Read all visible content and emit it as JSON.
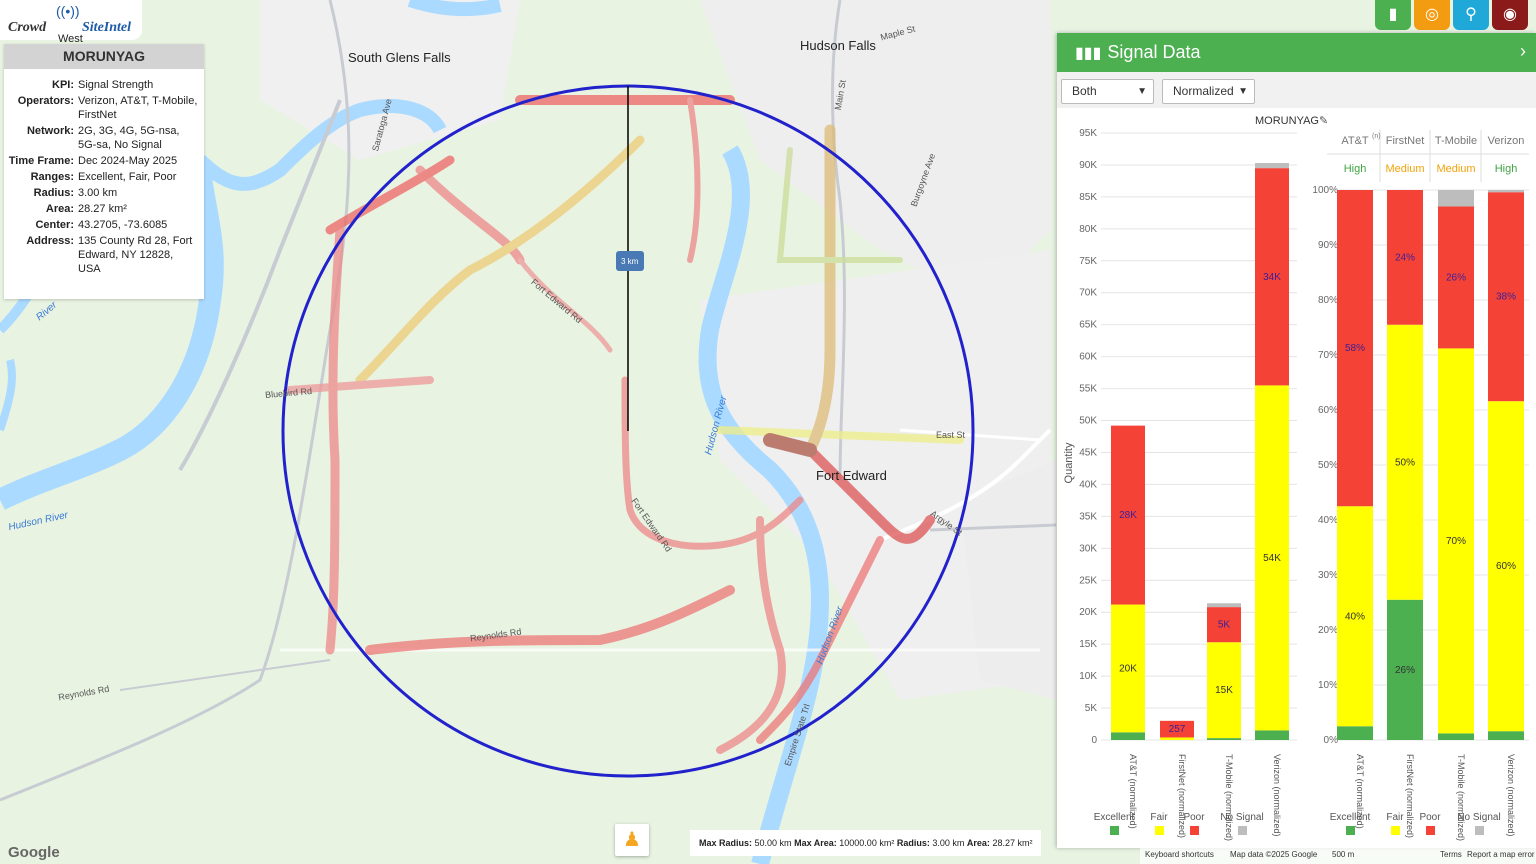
{
  "logo": {
    "word1": "Crowd",
    "word2": "SiteIntel",
    "under": "West"
  },
  "info": {
    "title": "MORUNYAG",
    "rows": [
      {
        "k": "KPI:",
        "v": "Signal Strength"
      },
      {
        "k": "Operators:",
        "v": "Verizon, AT&T, T-Mobile, FirstNet"
      },
      {
        "k": "Network:",
        "v": "2G, 3G, 4G, 5G-nsa, 5G-sa, No Signal"
      },
      {
        "k": "Time Frame:",
        "v": "Dec 2024-May 2025"
      },
      {
        "k": "Ranges:",
        "v": "Excellent, Fair, Poor"
      },
      {
        "k": "Radius:",
        "v": "3.00 km"
      },
      {
        "k": "Area:",
        "v": "28.27 km²"
      },
      {
        "k": "Center:",
        "v": "43.2705, -73.6085"
      },
      {
        "k": "Address:",
        "v": "135 County Rd 28, Fort Edward, NY 12828, USA"
      }
    ]
  },
  "toolbar": {
    "buttons": [
      {
        "name": "signal-data-button",
        "icon": "bar-chart-icon",
        "glyph": "▮",
        "color": "#4caf50"
      },
      {
        "name": "target-button",
        "icon": "target-icon",
        "glyph": "◎",
        "color": "#f39c12"
      },
      {
        "name": "location-button",
        "icon": "map-pin-icon",
        "glyph": "⚲",
        "color": "#1fa8d8"
      },
      {
        "name": "globe-button",
        "icon": "globe-icon",
        "glyph": "◉",
        "color": "#8b1a1a"
      }
    ]
  },
  "panel": {
    "title": "Signal Data",
    "select1": "Both",
    "select2": "Normalized",
    "chart_title": "MORUNYAG"
  },
  "map": {
    "labels": {
      "south_glens_falls": "South Glens Falls",
      "hudson_falls": "Hudson Falls",
      "fort_edward": "Fort Edward",
      "scale": "3 km",
      "river1": "Hudson River",
      "river2": "Hudson River",
      "river3": "Hudson River",
      "river4": "River",
      "road1": "Fort Edward Rd",
      "road2": "Fort Edward Rd",
      "road3": "Reynolds Rd",
      "road4": "Bluebird Rd",
      "road5": "East St",
      "road6": "Maple St",
      "road7": "Burgoyne Ave",
      "road8": "Reynolds Rd",
      "road9": "Saratoga Ave",
      "road10": "Main St",
      "road11": "Empire State Trl",
      "road12": "Argyle St"
    },
    "footer": {
      "max_radius_label": "Max Radius:",
      "max_radius": "50.00 km",
      "max_area_label": "Max Area:",
      "max_area": "10000.00 km²",
      "radius_label": "Radius:",
      "radius": "3.00 km",
      "area_label": "Area:",
      "area": "28.27 km²"
    },
    "attribution": {
      "keyboard": "Keyboard shortcuts",
      "mapdata": "Map data ©2025 Google",
      "scale": "500 m",
      "terms": "Terms",
      "report": "Report a map error"
    },
    "google": "Google"
  },
  "chart_data": [
    {
      "type": "bar",
      "stacked": true,
      "title": "MORUNYAG",
      "ylabel": "Quantity",
      "ylim": [
        0,
        95000
      ],
      "yticks": [
        "0",
        "5K",
        "10K",
        "15K",
        "20K",
        "25K",
        "30K",
        "35K",
        "40K",
        "45K",
        "50K",
        "55K",
        "60K",
        "65K",
        "70K",
        "75K",
        "80K",
        "85K",
        "90K",
        "95K"
      ],
      "categories": [
        "AT&T (normalized)",
        "FirstNet (normalized)",
        "T-Mobile (normalized)",
        "Verizon (normalized)"
      ],
      "series": [
        {
          "name": "Excellent",
          "color": "#4caf50",
          "values": [
            1200,
            0,
            300,
            1500
          ]
        },
        {
          "name": "Fair",
          "color": "#ffff00",
          "values": [
            20000,
            400,
            15000,
            54000
          ]
        },
        {
          "name": "Poor",
          "color": "#f44336",
          "values": [
            28000,
            2600,
            5500,
            34000
          ]
        },
        {
          "name": "No Signal",
          "color": "#bdbdbd",
          "values": [
            0,
            0,
            600,
            800
          ]
        }
      ],
      "data_labels": [
        {
          "cat": 0,
          "series": 1,
          "text": "20K"
        },
        {
          "cat": 0,
          "series": 2,
          "text": "28K"
        },
        {
          "cat": 1,
          "series": 2,
          "text": "257"
        },
        {
          "cat": 2,
          "series": 1,
          "text": "15K"
        },
        {
          "cat": 2,
          "series": 2,
          "text": "5K"
        },
        {
          "cat": 3,
          "series": 1,
          "text": "54K"
        },
        {
          "cat": 3,
          "series": 2,
          "text": "34K"
        }
      ]
    },
    {
      "type": "bar",
      "stacked": true,
      "ylim": [
        0,
        100
      ],
      "yticks": [
        "0%",
        "10%",
        "20%",
        "30%",
        "40%",
        "50%",
        "60%",
        "70%",
        "80%",
        "90%",
        "100%"
      ],
      "categories": [
        "AT&T (normalized)",
        "FirstNet (normalized)",
        "T-Mobile (normalized)",
        "Verizon (normalized)"
      ],
      "column_headers": [
        "AT&T",
        "FirstNet",
        "T-Mobile",
        "Verizon"
      ],
      "column_header_suffix": "(n)",
      "ratings": [
        {
          "text": "High",
          "color": "#3ea541"
        },
        {
          "text": "Medium",
          "color": "#f0a30a"
        },
        {
          "text": "Medium",
          "color": "#f0a30a"
        },
        {
          "text": "High",
          "color": "#3ea541"
        }
      ],
      "series": [
        {
          "name": "Excellent",
          "color": "#4caf50",
          "values": [
            2.5,
            25.5,
            1.2,
            1.6
          ]
        },
        {
          "name": "Fair",
          "color": "#ffff00",
          "values": [
            40,
            50,
            70,
            60
          ]
        },
        {
          "name": "Poor",
          "color": "#f44336",
          "values": [
            57.5,
            24.5,
            25.8,
            38
          ]
        },
        {
          "name": "No Signal",
          "color": "#bdbdbd",
          "values": [
            0,
            0,
            3,
            0.4
          ]
        }
      ],
      "data_labels": [
        {
          "cat": 0,
          "series": 1,
          "text": "40%"
        },
        {
          "cat": 0,
          "series": 2,
          "text": "58%"
        },
        {
          "cat": 1,
          "series": 0,
          "text": "26%"
        },
        {
          "cat": 1,
          "series": 1,
          "text": "50%"
        },
        {
          "cat": 1,
          "series": 2,
          "text": "24%"
        },
        {
          "cat": 2,
          "series": 1,
          "text": "70%"
        },
        {
          "cat": 2,
          "series": 2,
          "text": "26%"
        },
        {
          "cat": 3,
          "series": 1,
          "text": "60%"
        },
        {
          "cat": 3,
          "series": 2,
          "text": "38%"
        }
      ]
    }
  ],
  "legend": [
    "Excellent",
    "Fair",
    "Poor",
    "No Signal"
  ]
}
